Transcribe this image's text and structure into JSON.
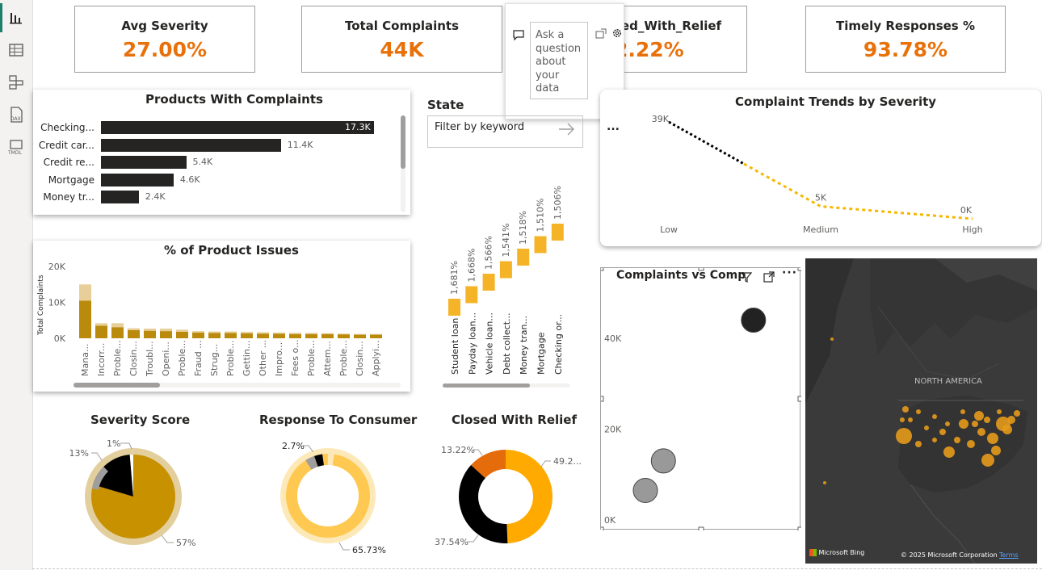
{
  "kpis": [
    {
      "title": "Avg Severity",
      "value": "27.00%"
    },
    {
      "title": "Total Complaints",
      "value": "44K"
    },
    {
      "title": "sed_With_Relief",
      "value": "2.22%"
    },
    {
      "title": "Timely Responses %",
      "value": "93.78%"
    }
  ],
  "qa": {
    "placeholder": "Ask a question about your data"
  },
  "products": {
    "title": "Products With Complaints",
    "items": [
      {
        "label": "Checking...",
        "value": "17.3K",
        "v": 17.3
      },
      {
        "label": "Credit car...",
        "value": "11.4K",
        "v": 11.4
      },
      {
        "label": "Credit re...",
        "value": "5.4K",
        "v": 5.4
      },
      {
        "label": "Mortgage",
        "value": "4.6K",
        "v": 4.6
      },
      {
        "label": "Money tr...",
        "value": "2.4K",
        "v": 2.4
      }
    ]
  },
  "state": {
    "title": "State",
    "placeholder": "Filter by keyword"
  },
  "trends": {
    "title": "Complaint Trends by Severity",
    "more": "...",
    "points": [
      {
        "label": "Low",
        "value": "39K"
      },
      {
        "label": "Medium",
        "value": "5K"
      },
      {
        "label": "High",
        "value": "0K"
      }
    ]
  },
  "issues": {
    "title": "% of Product Issues",
    "ylabel": "Total Complaints",
    "yticks": [
      "20K",
      "10K",
      "0K"
    ],
    "categories": [
      "Mana...",
      "Incorr...",
      "Proble...",
      "Closin...",
      "Troubl...",
      "Openi...",
      "Proble...",
      "Fraud ...",
      "Strug...",
      "Proble...",
      "Gettin...",
      "Other ...",
      "Impro...",
      "Fees o...",
      "Proble...",
      "Attem...",
      "Proble...",
      "Closin...",
      "Applyi..."
    ]
  },
  "waterfall": {
    "categories": [
      "Student loan",
      "Payday loan...",
      "Vehicle loan...",
      "Debt collect...",
      "Money tran...",
      "Mortgage",
      "Checking or..."
    ],
    "labels": [
      "1,681%",
      "1,668%",
      "1,566%",
      "1,541%",
      "1,518%",
      "1,510%",
      "1,506%"
    ]
  },
  "scatter": {
    "title": "Complaints vs Comp",
    "yticks": [
      "40K",
      "20K",
      "0K"
    ]
  },
  "map": {
    "region": "NORTH AMERICA",
    "brand": "Microsoft Bing",
    "copyright": "© 2025 Microsoft Corporation",
    "terms": "Terms"
  },
  "severity": {
    "title": "Severity Score",
    "labels": [
      "13%",
      "1%",
      "57%"
    ]
  },
  "response": {
    "title": "Response To Consumer",
    "labels": [
      "2.7%",
      "65.73%"
    ]
  },
  "relief": {
    "title": "Closed With Relief",
    "labels": [
      "13.22%",
      "49.2...",
      "37.54%"
    ]
  },
  "chart_data": [
    {
      "type": "bar",
      "title": "Products With Complaints",
      "categories": [
        "Checking...",
        "Credit car...",
        "Credit re...",
        "Mortgage",
        "Money tr..."
      ],
      "values": [
        17300,
        11400,
        5400,
        4600,
        2400
      ]
    },
    {
      "type": "bar",
      "title": "% of Product Issues",
      "ylabel": "Total Complaints",
      "ylim": [
        0,
        20000
      ],
      "categories": [
        "Mana...",
        "Incorr...",
        "Proble...",
        "Closin...",
        "Troubl...",
        "Openi...",
        "Proble...",
        "Fraud ...",
        "Strug...",
        "Proble...",
        "Gettin...",
        "Other ...",
        "Impro...",
        "Fees o...",
        "Proble...",
        "Attem...",
        "Proble...",
        "Closin...",
        "Applyi..."
      ],
      "series": [
        {
          "values": [
            10500,
            3500,
            3100,
            2300,
            2100,
            2000,
            1800,
            1600,
            1500,
            1500,
            1400,
            1300,
            1300,
            1200,
            1200,
            1200,
            1100,
            1000,
            1000
          ]
        },
        {
          "values": [
            4500,
            700,
            1100,
            500,
            600,
            700,
            600,
            400,
            400,
            400,
            400,
            400,
            300,
            300,
            300,
            200,
            200,
            200,
            200
          ]
        }
      ]
    },
    {
      "type": "bar",
      "title": "",
      "categories": [
        "Student loan",
        "Payday loan...",
        "Vehicle loan...",
        "Debt collect...",
        "Money tran...",
        "Mortgage",
        "Checking or..."
      ],
      "values": [
        1681,
        1668,
        1566,
        1541,
        1518,
        1510,
        1506
      ]
    },
    {
      "type": "line",
      "title": "Complaint Trends by Severity",
      "categories": [
        "Low",
        "Medium",
        "High"
      ],
      "values": [
        39000,
        5000,
        0
      ]
    },
    {
      "type": "scatter",
      "title": "Complaints vs Comp",
      "ylim": [
        0,
        50000
      ],
      "series": [
        {
          "values": [
            [
              8,
              44000
            ],
            [
              3,
              13000
            ],
            [
              2,
              6500
            ]
          ]
        }
      ]
    },
    {
      "type": "pie",
      "title": "Severity Score",
      "labels": [
        "13%",
        "1%",
        "57%"
      ],
      "values": [
        13,
        1,
        57
      ]
    },
    {
      "type": "pie",
      "title": "Response To Consumer",
      "labels": [
        "2.7%",
        "65.73%"
      ],
      "values": [
        2.7,
        65.73
      ]
    },
    {
      "type": "pie",
      "title": "Closed With Relief",
      "labels": [
        "13.22%",
        "49.2...",
        "37.54%"
      ],
      "values": [
        13.22,
        49.2,
        37.54
      ]
    }
  ]
}
